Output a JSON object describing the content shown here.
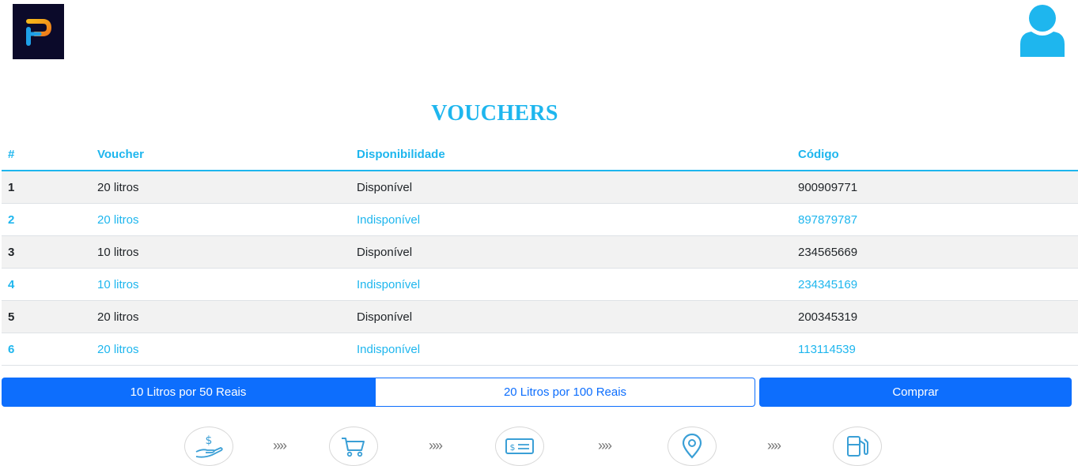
{
  "page": {
    "title": "VOUCHERS"
  },
  "header": {
    "logo_icon": "p-logo-icon",
    "user_icon": "user-avatar-icon"
  },
  "table": {
    "headers": [
      "#",
      "Voucher",
      "Disponibilidade",
      "Código"
    ],
    "rows": [
      {
        "num": "1",
        "voucher": "20 litros",
        "status": "Disponível",
        "code": "900909771"
      },
      {
        "num": "2",
        "voucher": "20 litros",
        "status": "Indisponível",
        "code": "897879787"
      },
      {
        "num": "3",
        "voucher": "10 litros",
        "status": "Disponível",
        "code": "234565669"
      },
      {
        "num": "4",
        "voucher": "10 litros",
        "status": "Indisponível",
        "code": "234345169"
      },
      {
        "num": "5",
        "voucher": "20 litros",
        "status": "Disponível",
        "code": "200345319"
      },
      {
        "num": "6",
        "voucher": "20 litros",
        "status": "Indisponível",
        "code": "113114539"
      }
    ]
  },
  "purchase": {
    "option_a": "10 Litros por 50 Reais",
    "option_b": "20 Litros por 100 Reais",
    "buy_label": "Comprar",
    "selected": "option_a"
  },
  "steps": {
    "icons": [
      "hand-money-icon",
      "cart-icon",
      "check-icon",
      "location-pin-icon",
      "fuel-pump-icon"
    ],
    "separator": "»"
  },
  "colors": {
    "accent": "#1eb6ee",
    "button": "#0d6efd",
    "logo_bg": "#0b0a2a"
  }
}
